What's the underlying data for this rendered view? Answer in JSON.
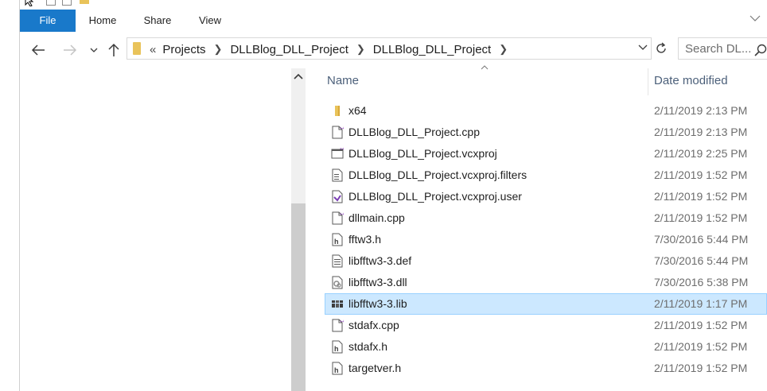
{
  "titlebar": {
    "path_fragment": "· . . ·"
  },
  "ribbon": {
    "tabs": [
      {
        "label": "File",
        "active": true
      },
      {
        "label": "Home"
      },
      {
        "label": "Share"
      },
      {
        "label": "View"
      }
    ],
    "accent_color": "#1979ca"
  },
  "address": {
    "overflow": "«",
    "breadcrumbs": [
      "Projects",
      "DLLBlog_DLL_Project",
      "DLLBlog_DLL_Project"
    ]
  },
  "search": {
    "placeholder": "Search DL..."
  },
  "columns": {
    "name": "Name",
    "date_modified": "Date modified"
  },
  "files": [
    {
      "name": "x64",
      "date": "2/11/2019 2:13 PM",
      "icon": "folder-icon"
    },
    {
      "name": "DLLBlog_DLL_Project.cpp",
      "date": "2/11/2019 2:13 PM",
      "icon": "cpp-file-icon"
    },
    {
      "name": "DLLBlog_DLL_Project.vcxproj",
      "date": "2/11/2019 2:25 PM",
      "icon": "vcxproj-file-icon"
    },
    {
      "name": "DLLBlog_DLL_Project.vcxproj.filters",
      "date": "2/11/2019 1:52 PM",
      "icon": "filters-file-icon"
    },
    {
      "name": "DLLBlog_DLL_Project.vcxproj.user",
      "date": "2/11/2019 1:52 PM",
      "icon": "vs-user-file-icon"
    },
    {
      "name": "dllmain.cpp",
      "date": "2/11/2019 1:52 PM",
      "icon": "cpp-file-icon"
    },
    {
      "name": "fftw3.h",
      "date": "7/30/2016 5:44 PM",
      "icon": "header-file-icon"
    },
    {
      "name": "libfftw3-3.def",
      "date": "7/30/2016 5:44 PM",
      "icon": "text-file-icon"
    },
    {
      "name": "libfftw3-3.dll",
      "date": "7/30/2016 5:38 PM",
      "icon": "dll-file-icon"
    },
    {
      "name": "libfftw3-3.lib",
      "date": "2/11/2019 1:17 PM",
      "icon": "lib-file-icon",
      "selected": true
    },
    {
      "name": "stdafx.cpp",
      "date": "2/11/2019 1:52 PM",
      "icon": "cpp-file-icon"
    },
    {
      "name": "stdafx.h",
      "date": "2/11/2019 1:52 PM",
      "icon": "header-file-icon"
    },
    {
      "name": "targetver.h",
      "date": "2/11/2019 1:52 PM",
      "icon": "header-file-icon"
    }
  ],
  "selection_color": "#cce8ff"
}
